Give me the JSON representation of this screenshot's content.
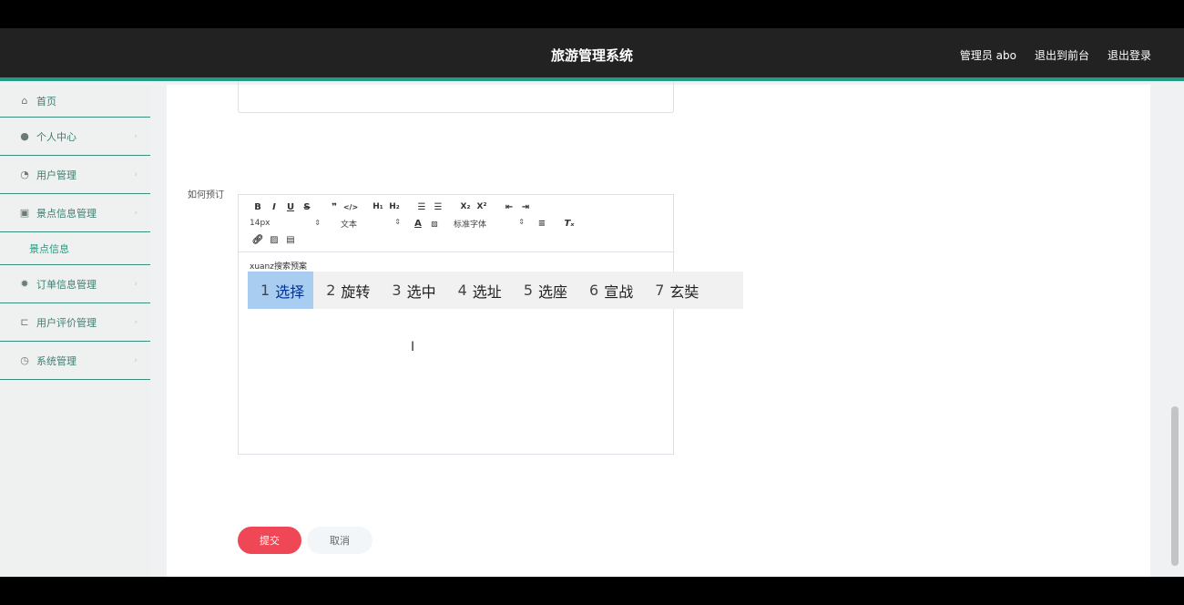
{
  "header": {
    "title": "旅游管理系统",
    "user": "管理员 abo",
    "to_front": "退出到前台",
    "logout": "退出登录"
  },
  "sidebar": {
    "items": [
      {
        "label": "首页",
        "icon": "home-icon"
      },
      {
        "label": "个人中心",
        "icon": "user-icon"
      },
      {
        "label": "用户管理",
        "icon": "users-icon"
      },
      {
        "label": "景点信息管理",
        "icon": "grid-icon"
      },
      {
        "label": "订单信息管理",
        "icon": "gear-icon"
      },
      {
        "label": "用户评价管理",
        "icon": "cart-icon"
      },
      {
        "label": "系统管理",
        "icon": "clock-icon"
      }
    ],
    "sub_item": "景点信息"
  },
  "form": {
    "field_label": "如何预订",
    "editor": {
      "font_size": "14px",
      "text_type": "文本",
      "font_family": "标准字体",
      "typed_text": "xuanz搜索预案"
    },
    "submit_label": "提交",
    "cancel_label": "取消"
  },
  "ime": {
    "candidates": [
      {
        "num": "1",
        "text": "选择"
      },
      {
        "num": "2",
        "text": "旋转"
      },
      {
        "num": "3",
        "text": "选中"
      },
      {
        "num": "4",
        "text": "选址"
      },
      {
        "num": "5",
        "text": "选座"
      },
      {
        "num": "6",
        "text": "宣战"
      },
      {
        "num": "7",
        "text": "玄奘"
      }
    ]
  },
  "colors": {
    "accent": "#1f9e84",
    "topbar": "#222222",
    "submit": "#f04756"
  }
}
